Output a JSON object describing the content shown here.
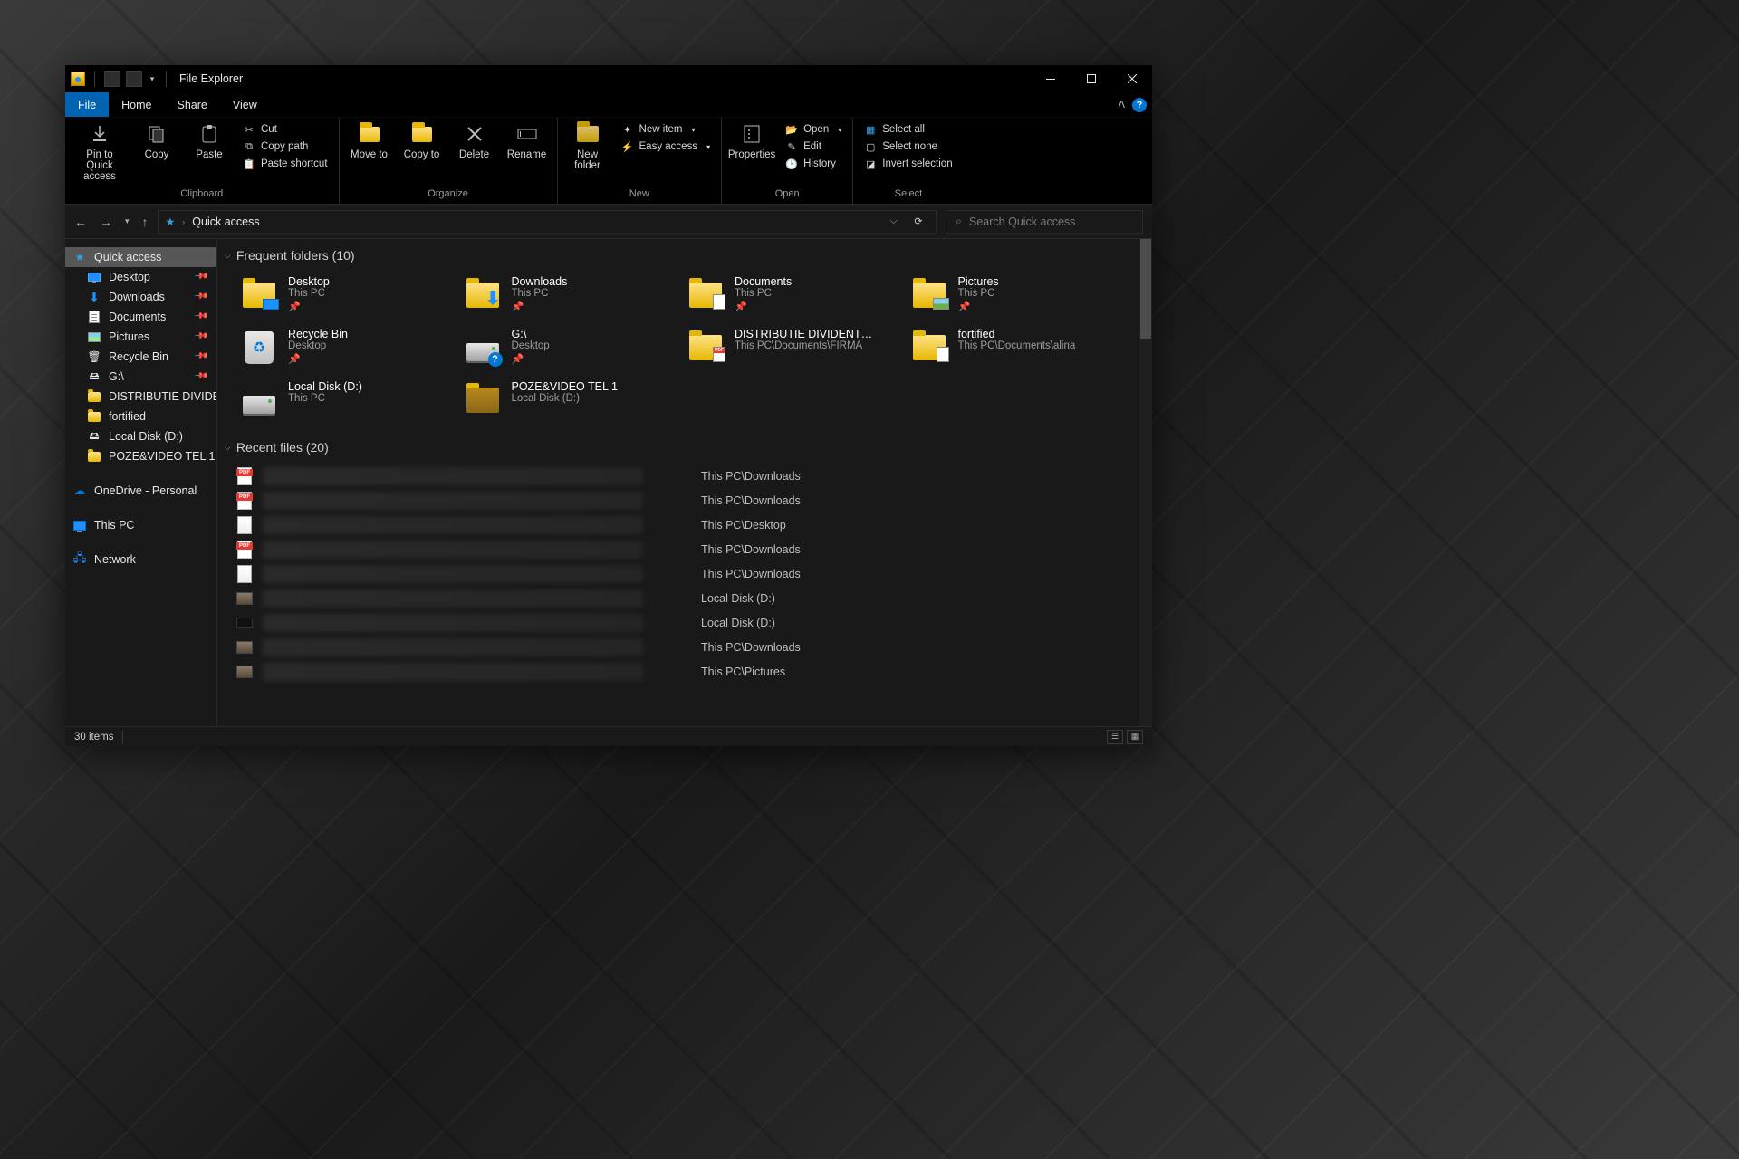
{
  "title": "File Explorer",
  "menu": {
    "file": "File",
    "home": "Home",
    "share": "Share",
    "view": "View"
  },
  "ribbon": {
    "clipboard": {
      "label": "Clipboard",
      "pin": "Pin to Quick access",
      "copy": "Copy",
      "paste": "Paste",
      "cut": "Cut",
      "copypath": "Copy path",
      "pasteshortcut": "Paste shortcut"
    },
    "organize": {
      "label": "Organize",
      "moveto": "Move to",
      "copyto": "Copy to",
      "delete": "Delete",
      "rename": "Rename"
    },
    "new": {
      "label": "New",
      "newfolder": "New folder",
      "newitem": "New item",
      "easyaccess": "Easy access"
    },
    "open": {
      "label": "Open",
      "properties": "Properties",
      "open": "Open",
      "edit": "Edit",
      "history": "History"
    },
    "select": {
      "label": "Select",
      "selectall": "Select all",
      "selectnone": "Select none",
      "invert": "Invert selection"
    }
  },
  "address": {
    "location": "Quick access"
  },
  "search": {
    "placeholder": "Search Quick access"
  },
  "sidebar": {
    "quickaccess": "Quick access",
    "items": [
      {
        "label": "Desktop",
        "icon": "monitor",
        "pinned": true
      },
      {
        "label": "Downloads",
        "icon": "download",
        "pinned": true
      },
      {
        "label": "Documents",
        "icon": "doc",
        "pinned": true
      },
      {
        "label": "Pictures",
        "icon": "pic",
        "pinned": true
      },
      {
        "label": "Recycle Bin",
        "icon": "recycle",
        "pinned": true
      },
      {
        "label": "G:\\",
        "icon": "drive",
        "pinned": true
      },
      {
        "label": "DISTRIBUTIE DIVIDEN",
        "icon": "folder",
        "pinned": false
      },
      {
        "label": "fortified",
        "icon": "folder",
        "pinned": false
      },
      {
        "label": "Local Disk (D:)",
        "icon": "drive",
        "pinned": false
      },
      {
        "label": "POZE&VIDEO TEL 1",
        "icon": "folder",
        "pinned": false
      }
    ],
    "onedrive": "OneDrive - Personal",
    "thispc": "This PC",
    "network": "Network"
  },
  "sections": {
    "frequent": "Frequent folders (10)",
    "recent": "Recent files (20)"
  },
  "folders": [
    {
      "name": "Desktop",
      "loc": "This PC",
      "icon": "desktop",
      "pinned": true
    },
    {
      "name": "Downloads",
      "loc": "This PC",
      "icon": "downloads",
      "pinned": true
    },
    {
      "name": "Documents",
      "loc": "This PC",
      "icon": "documents",
      "pinned": true
    },
    {
      "name": "Pictures",
      "loc": "This PC",
      "icon": "pictures",
      "pinned": true
    },
    {
      "name": "Recycle Bin",
      "loc": "Desktop",
      "icon": "recyclebin",
      "pinned": true
    },
    {
      "name": "G:\\",
      "loc": "Desktop",
      "icon": "driveq",
      "pinned": true
    },
    {
      "name": "DISTRIBUTIE DIVIDENTE IU...",
      "loc": "This PC\\Documents\\FIRMA",
      "icon": "pdffolder",
      "pinned": false
    },
    {
      "name": "fortified",
      "loc": "This PC\\Documents\\alina",
      "icon": "openfolder",
      "pinned": false
    },
    {
      "name": "Local Disk (D:)",
      "loc": "This PC",
      "icon": "drive",
      "pinned": false
    },
    {
      "name": "POZE&VIDEO TEL 1",
      "loc": "Local Disk (D:)",
      "icon": "mediafolder",
      "pinned": false
    }
  ],
  "recent": [
    {
      "icon": "pdf",
      "loc": "This PC\\Downloads"
    },
    {
      "icon": "pdf",
      "loc": "This PC\\Downloads"
    },
    {
      "icon": "page",
      "loc": "This PC\\Desktop"
    },
    {
      "icon": "pdf",
      "loc": "This PC\\Downloads"
    },
    {
      "icon": "page",
      "loc": "This PC\\Downloads"
    },
    {
      "icon": "thumb",
      "loc": "Local Disk (D:)"
    },
    {
      "icon": "black",
      "loc": "Local Disk (D:)"
    },
    {
      "icon": "thumb",
      "loc": "This PC\\Downloads"
    },
    {
      "icon": "thumb",
      "loc": "This PC\\Pictures"
    }
  ],
  "status": {
    "items": "30 items"
  }
}
